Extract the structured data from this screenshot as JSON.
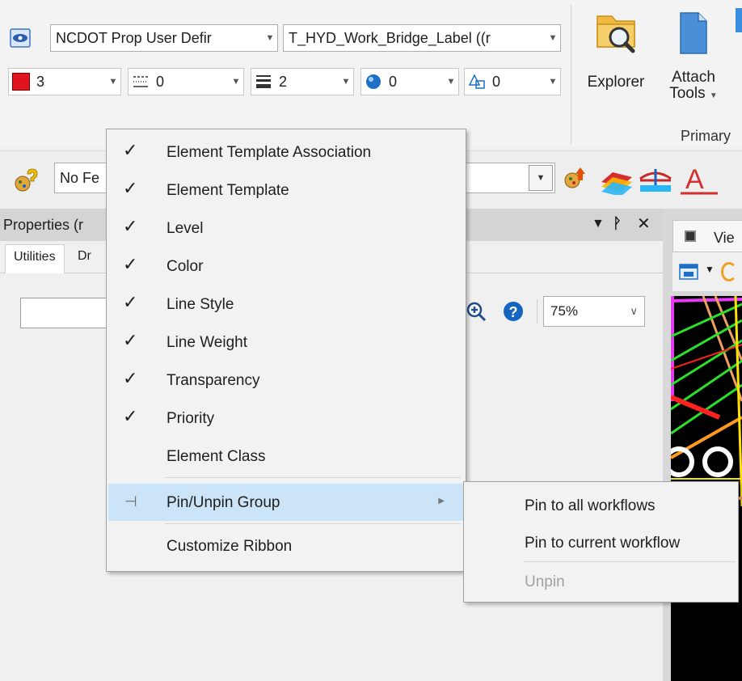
{
  "ribbon": {
    "level_combo": "NCDOT Prop User Defir",
    "template_combo": "T_HYD_Work_Bridge_Label ((r",
    "attributes": [
      {
        "name": "color",
        "value": "3"
      },
      {
        "name": "line-style",
        "value": "0"
      },
      {
        "name": "line-weight",
        "value": "2"
      },
      {
        "name": "transparency",
        "value": "0"
      },
      {
        "name": "priority",
        "value": "0"
      }
    ],
    "explorer_label": "Explorer",
    "attach_tools_label_1": "Attach",
    "attach_tools_label_2": "Tools",
    "group_label": "Primary"
  },
  "feature_toolbar": {
    "feature_combo": "No Fe"
  },
  "properties_panel": {
    "title": "Properties (r",
    "tabs": [
      "Utilities",
      "Dr"
    ],
    "zoom": "75%"
  },
  "view_panel": {
    "tab_label": "Vie"
  },
  "context_menu": {
    "items": [
      {
        "label": "Element Template Association",
        "checked": true
      },
      {
        "label": "Element Template",
        "checked": true
      },
      {
        "label": "Level",
        "checked": true
      },
      {
        "label": "Color",
        "checked": true
      },
      {
        "label": "Line Style",
        "checked": true
      },
      {
        "label": "Line Weight",
        "checked": true
      },
      {
        "label": "Transparency",
        "checked": true
      },
      {
        "label": "Priority",
        "checked": true
      },
      {
        "label": "Element Class",
        "checked": false
      }
    ],
    "pin_group": "Pin/Unpin Group",
    "customize": "Customize Ribbon",
    "check_glyph": "✓"
  },
  "submenu": {
    "items": [
      {
        "label": "Pin to all workflows",
        "enabled": true
      },
      {
        "label": "Pin to current workflow",
        "enabled": true
      },
      {
        "label": "Unpin",
        "enabled": false
      }
    ]
  },
  "colors": {
    "menu_highlight": "#cce4f7",
    "element_color": "#e0141e",
    "accent_blue": "#1565c0"
  }
}
